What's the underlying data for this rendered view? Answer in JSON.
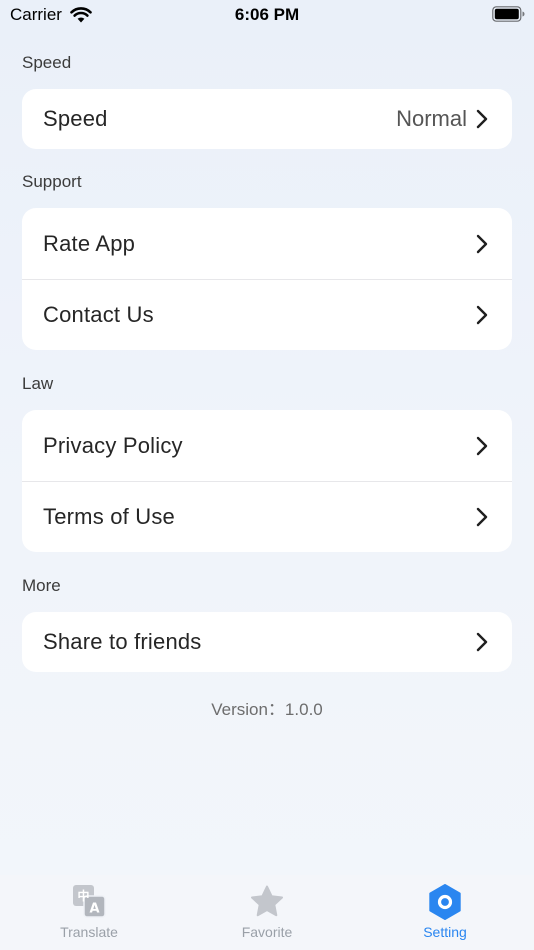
{
  "status_bar": {
    "carrier": "Carrier",
    "time": "6:06 PM"
  },
  "sections": {
    "speed": {
      "header": "Speed",
      "rows": [
        {
          "label": "Speed",
          "value": "Normal"
        }
      ]
    },
    "support": {
      "header": "Support",
      "rows": [
        {
          "label": "Rate App"
        },
        {
          "label": "Contact Us"
        }
      ]
    },
    "law": {
      "header": "Law",
      "rows": [
        {
          "label": "Privacy Policy"
        },
        {
          "label": "Terms of Use"
        }
      ]
    },
    "more": {
      "header": "More",
      "rows": [
        {
          "label": "Share to friends"
        }
      ]
    }
  },
  "version": "Version：1.0.0",
  "tabs": [
    {
      "label": "Translate",
      "icon": "translate-icon",
      "active": false
    },
    {
      "label": "Favorite",
      "icon": "star-icon",
      "active": false
    },
    {
      "label": "Setting",
      "icon": "settings-icon",
      "active": true
    }
  ],
  "colors": {
    "accent": "#2a86f0",
    "inactive": "#c3c6cc",
    "background": "#eef3fa"
  }
}
